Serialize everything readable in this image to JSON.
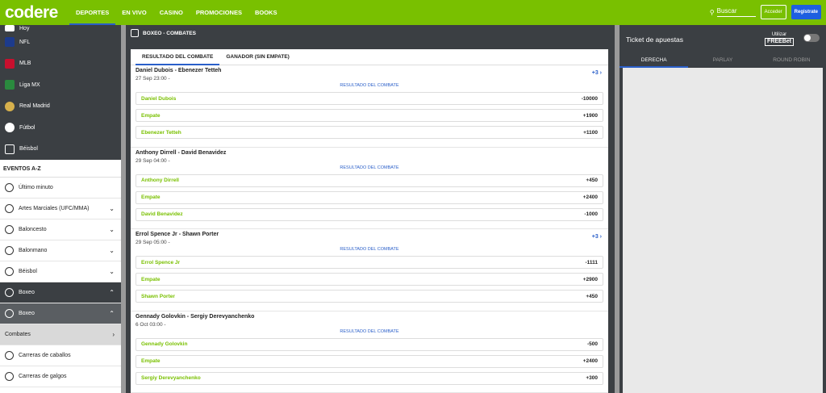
{
  "header": {
    "logo": "codere",
    "nav": [
      "DEPORTES",
      "EN VIVO",
      "CASINO",
      "PROMOCIONES",
      "BOOKS"
    ],
    "search_label": "Buscar",
    "login_label": "Acceder",
    "register_label": "Registrate"
  },
  "sidebar": {
    "sports": [
      {
        "label": "Hoy",
        "icon": "calendar-icon",
        "color": "#ffffff"
      },
      {
        "label": "NFL",
        "icon": "nfl-icon",
        "color": "#1d3b8c"
      },
      {
        "label": "MLB",
        "icon": "mlb-icon",
        "color": "#c8102e"
      },
      {
        "label": "Liga MX",
        "icon": "liga-mx-icon",
        "color": "#2a8a3e"
      },
      {
        "label": "Real Madrid",
        "icon": "real-madrid-icon",
        "color": "#d6b04c"
      },
      {
        "label": "Fútbol",
        "icon": "soccer-ball-icon",
        "color": "#ffffff"
      },
      {
        "label": "Béisbol",
        "icon": "baseball-icon",
        "color": "#ffffff"
      }
    ],
    "events_title": "EVENTOS A-Z",
    "events": [
      {
        "label": "Último minuto",
        "icon": "stopwatch-icon",
        "chevron": ""
      },
      {
        "label": "Artes Marciales (UFC/MMA)",
        "icon": "bicycle-icon",
        "chevron": "⌄"
      },
      {
        "label": "Baloncesto",
        "icon": "basketball-icon",
        "chevron": "⌄"
      },
      {
        "label": "Balonmano",
        "icon": "handball-icon",
        "chevron": "⌄"
      },
      {
        "label": "Béisbol",
        "icon": "baseball-bat-icon",
        "chevron": "⌄"
      },
      {
        "label": "Boxeo",
        "icon": "boxing-glove-icon",
        "chevron": "⌃"
      },
      {
        "label": "Boxeo",
        "icon": "globe-icon",
        "chevron": "⌃"
      },
      {
        "label": "Combates",
        "icon": "",
        "chevron": "›"
      },
      {
        "label": "Carreras de caballos",
        "icon": "horse-racing-icon",
        "chevron": ""
      },
      {
        "label": "Carreras de galgos",
        "icon": "greyhound-icon",
        "chevron": ""
      }
    ]
  },
  "main": {
    "title": "BOXEO - COMBATES",
    "tabs": [
      "RESULTADO DEL COMBATE",
      "GANADOR (SIN EMPATE)"
    ],
    "events": [
      {
        "name": "Daniel Dubois - Ebenezer Tetteh",
        "date": "27 Sep 23:00 -",
        "more": "+3 ›",
        "market": "RESULTADO DEL COMBATE",
        "odds": [
          {
            "name": "Daniel Dubois",
            "value": "-10000"
          },
          {
            "name": "Empate",
            "value": "+1900"
          },
          {
            "name": "Ebenezer Tetteh",
            "value": "+1100"
          }
        ]
      },
      {
        "name": "Anthony Dirrell - David Benavidez",
        "date": "29 Sep 04:00 -",
        "more": "",
        "market": "RESULTADO DEL COMBATE",
        "odds": [
          {
            "name": "Anthony Dirrell",
            "value": "+450"
          },
          {
            "name": "Empate",
            "value": "+2400"
          },
          {
            "name": "David Benavidez",
            "value": "-1000"
          }
        ]
      },
      {
        "name": "Errol Spence Jr - Shawn Porter",
        "date": "29 Sep 05:00 -",
        "more": "+3 ›",
        "market": "RESULTADO DEL COMBATE",
        "odds": [
          {
            "name": "Errol Spence Jr",
            "value": "-1111"
          },
          {
            "name": "Empate",
            "value": "+2900"
          },
          {
            "name": "Shawn Porter",
            "value": "+450"
          }
        ]
      },
      {
        "name": "Gennady Golovkin - Sergiy Derevyanchenko",
        "date": "6 Oct 03:00 -",
        "more": "",
        "market": "RESULTADO DEL COMBATE",
        "odds": [
          {
            "name": "Gennady Golovkin",
            "value": "-500"
          },
          {
            "name": "Empate",
            "value": "+2400"
          },
          {
            "name": "Sergiy Derevyanchenko",
            "value": "+300"
          }
        ]
      }
    ]
  },
  "ticket": {
    "title": "Ticket de apuestas",
    "use_label": "Utilizar",
    "freebet_label": "FREEBet",
    "tabs": [
      "DERECHA",
      "PARLAY",
      "ROUND ROBIN"
    ]
  },
  "colors": {
    "brand_green": "#79c000",
    "accent_blue": "#2a5fc9",
    "dark_bg": "#3b3f43"
  }
}
